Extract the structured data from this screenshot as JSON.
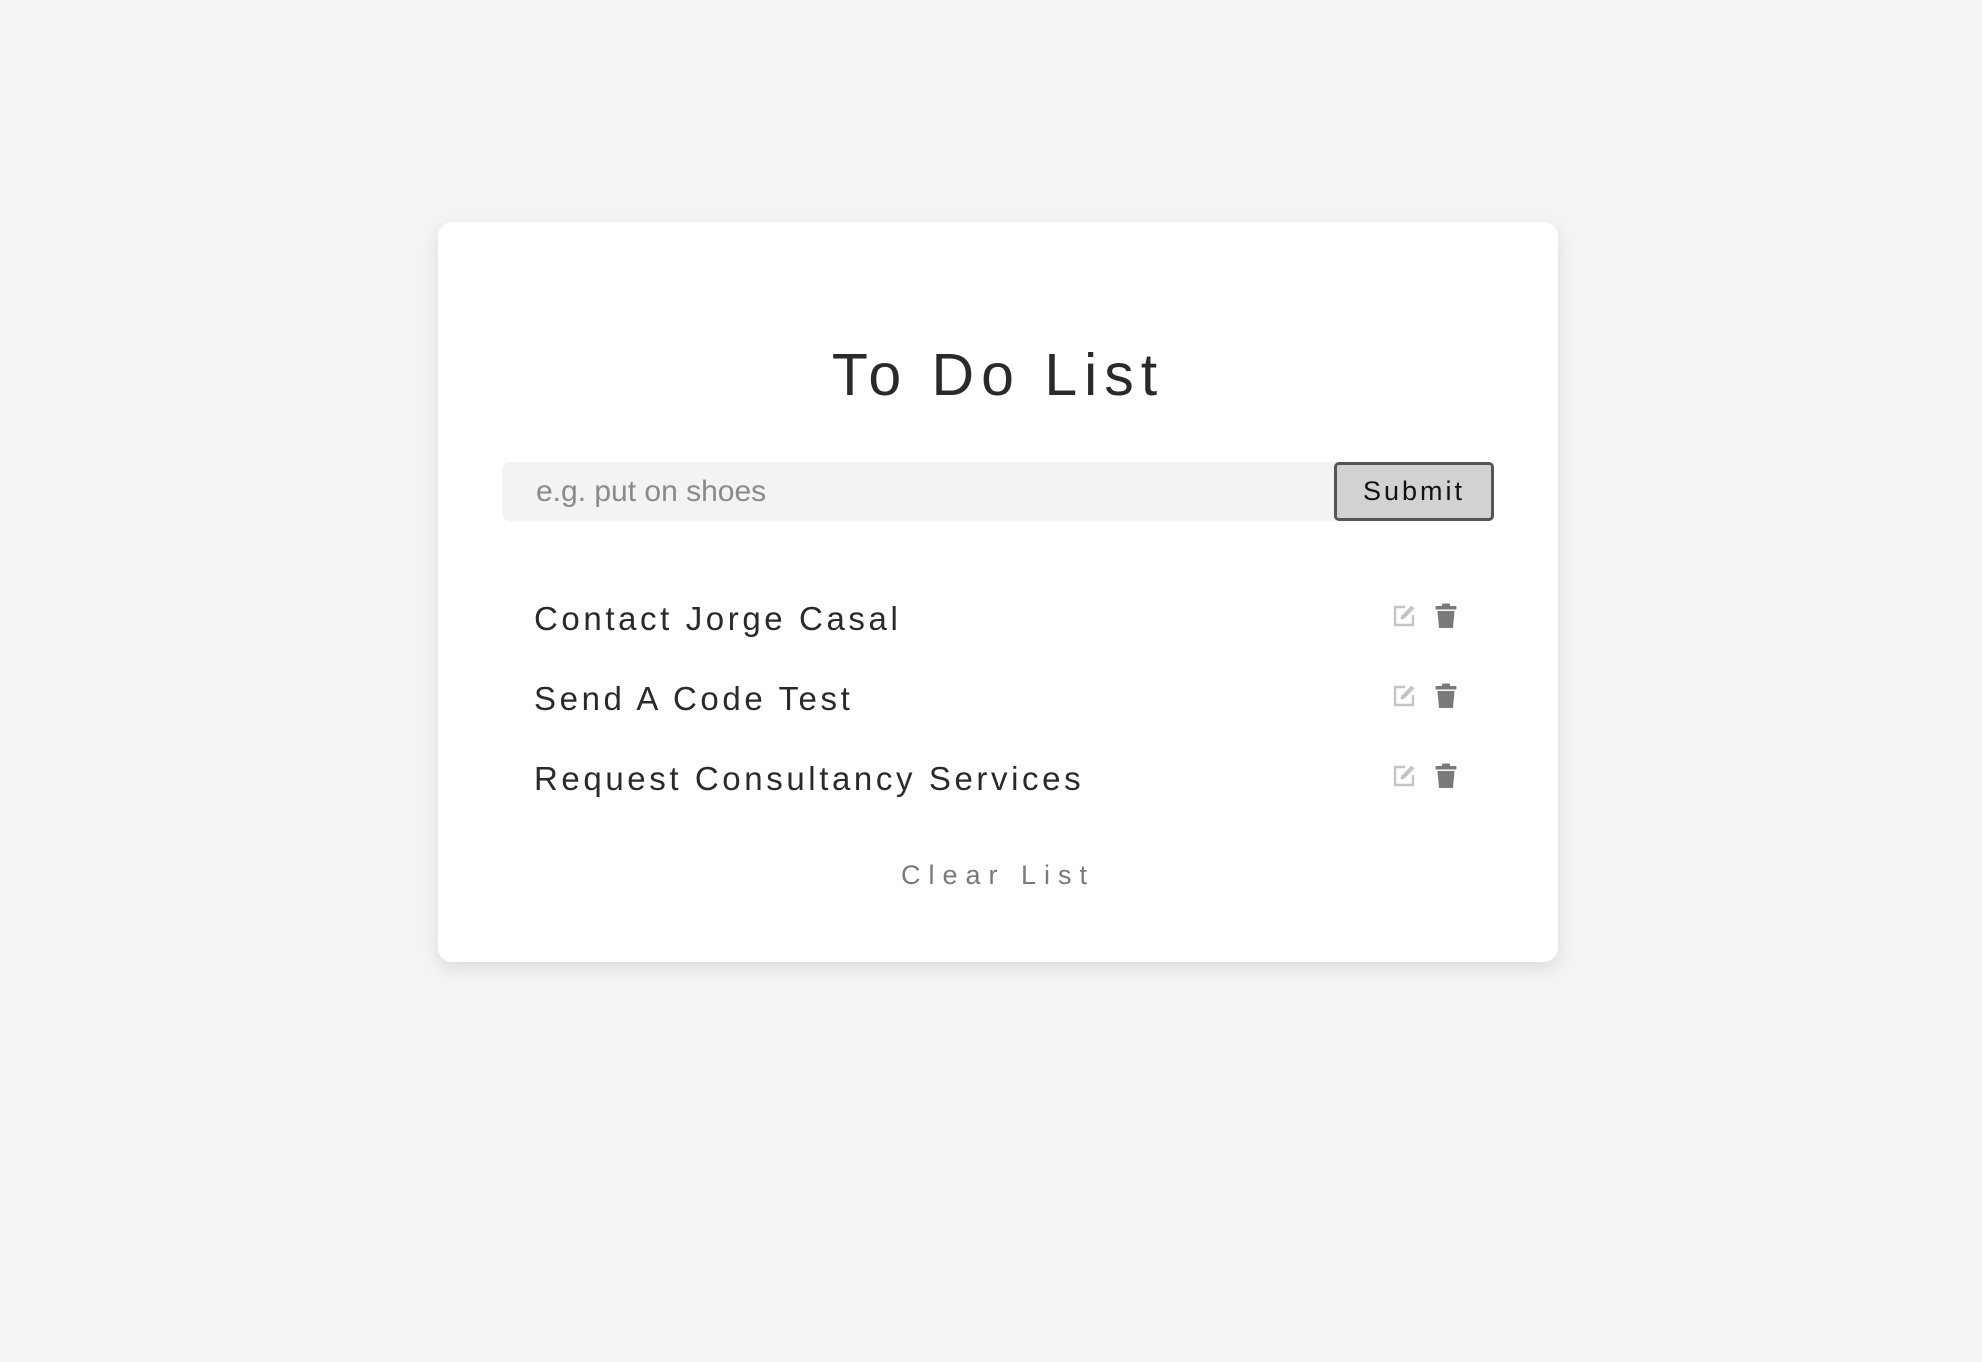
{
  "app": {
    "title": "To Do List"
  },
  "form": {
    "placeholder": "e.g. put on shoes",
    "value": "",
    "submit_label": "Submit"
  },
  "items": [
    {
      "text": "Contact Jorge Casal",
      "edit_icon": "edit-icon",
      "delete_icon": "trash-icon"
    },
    {
      "text": "Send A Code Test",
      "edit_icon": "edit-icon",
      "delete_icon": "trash-icon"
    },
    {
      "text": "Request Consultancy Services",
      "edit_icon": "edit-icon",
      "delete_icon": "trash-icon"
    }
  ],
  "clear_label": "Clear List",
  "colors": {
    "background": "#f4f4f4",
    "card": "#ffffff",
    "edit_icon": "#c4c4c4",
    "delete_icon": "#7a7a7a",
    "submit_bg": "#d2d2d2",
    "submit_border": "#555555"
  }
}
